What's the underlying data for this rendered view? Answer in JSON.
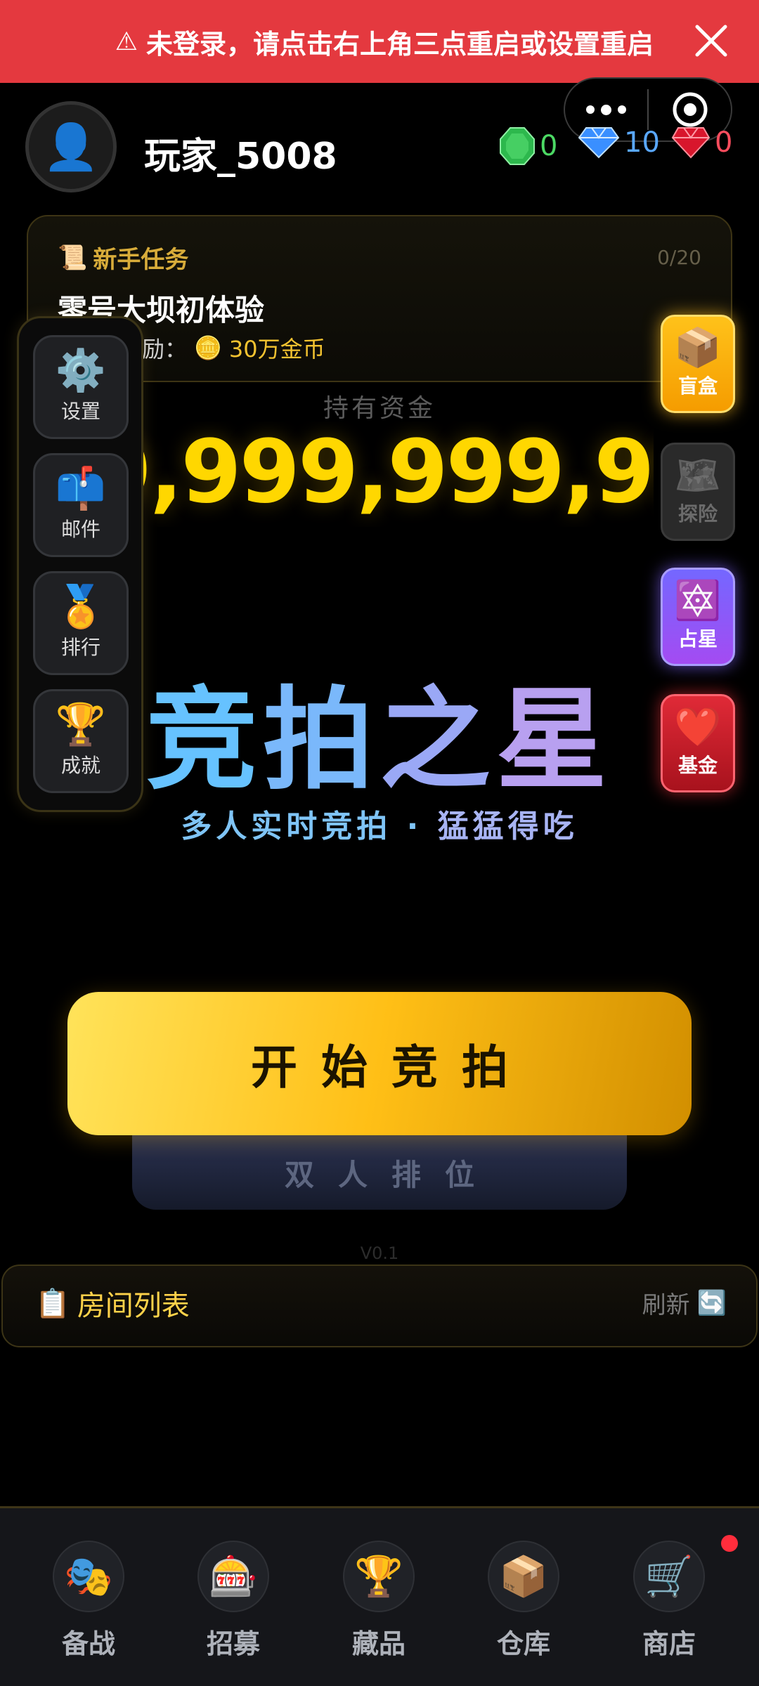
{
  "banner": {
    "text": "未登录，请点击右上角三点重启或设置重启",
    "icons": {
      "warning": "warning-triangle-icon",
      "close": "close-icon"
    }
  },
  "capsule": {
    "icons": {
      "more": "more-dots-icon",
      "exit": "target-circle-icon"
    }
  },
  "player": {
    "name": "玩家_5008",
    "avatar_icon": "user-silhouette-icon",
    "gems": [
      {
        "icon": "green-gem-icon",
        "value": "0",
        "color": "#4cd964"
      },
      {
        "icon": "blue-gem-icon",
        "value": "10",
        "color": "#5aa8ff"
      },
      {
        "icon": "red-gem-icon",
        "value": "0",
        "color": "#ff4d5e"
      }
    ]
  },
  "mission": {
    "tag": "新手任务",
    "tag_icon": "scroll-icon",
    "progress": "0/20",
    "title": "零号大坝初体验",
    "reward_prefix": "奖励：",
    "reward_icon": "coin-icon",
    "reward_amount": "30万金币"
  },
  "funds": {
    "label": "持有资金",
    "value": "9,999,999,999"
  },
  "title": {
    "chars": [
      "竞",
      "拍",
      "之",
      "星"
    ],
    "subtitle_left": "多人实时竞拍",
    "subtitle_sep": "·",
    "subtitle_right": "猛猛得吃"
  },
  "left_menu": [
    {
      "label": "设置",
      "icon": "gear-icon"
    },
    {
      "label": "邮件",
      "icon": "mailbox-icon"
    },
    {
      "label": "排行",
      "icon": "medal-icon"
    },
    {
      "label": "成就",
      "icon": "trophy-icon"
    }
  ],
  "right_menu": [
    {
      "label": "盲盒",
      "icon": "box-icon"
    },
    {
      "label": "探险",
      "icon": "map-icon"
    },
    {
      "label": "占星",
      "icon": "star-of-david-icon"
    },
    {
      "label": "基金",
      "icon": "heart-icon"
    }
  ],
  "actions": {
    "start": "开始竞拍",
    "duo": "双人排位"
  },
  "version": "V0.1",
  "room_list": {
    "title": "房间列表",
    "title_icon": "clipboard-icon",
    "refresh": "刷新",
    "refresh_icon": "refresh-arrows-icon"
  },
  "bottom_nav": [
    {
      "label": "备战",
      "icon": "performing-arts-icon"
    },
    {
      "label": "招募",
      "icon": "slot-machine-icon"
    },
    {
      "label": "藏品",
      "icon": "trophy-icon"
    },
    {
      "label": "仓库",
      "icon": "package-icon"
    },
    {
      "label": "商店",
      "icon": "shopping-cart-icon",
      "badge": true
    }
  ],
  "colors": {
    "banner": "#e4393f",
    "gold": "#ffd700",
    "accent_yellow": "#ffbf16"
  }
}
